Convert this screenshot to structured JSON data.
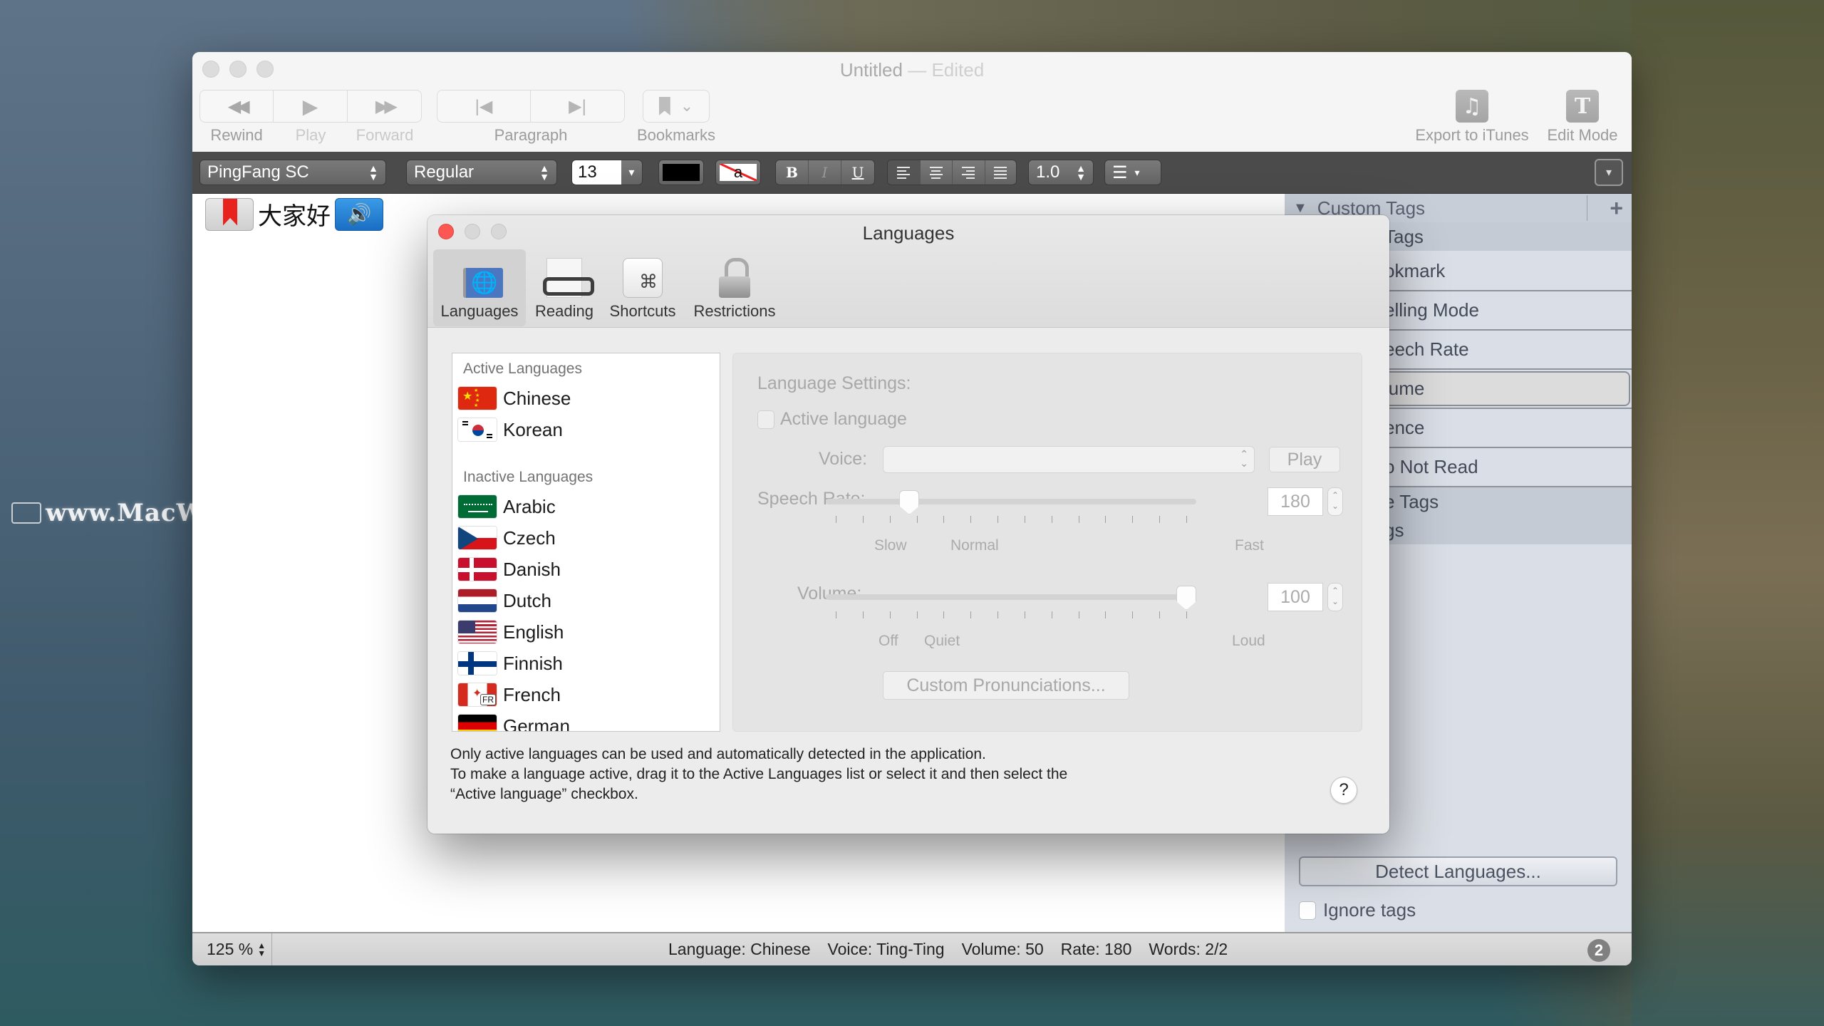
{
  "desktop": {
    "watermark": "www.MacW.com"
  },
  "window": {
    "title": "Untitled",
    "title_separator": "—",
    "title_status": "Edited"
  },
  "toolbar": {
    "rewind": {
      "label": "Rewind",
      "icon": "rewind-icon",
      "glyph": "◀◀"
    },
    "play": {
      "label": "Play",
      "icon": "play-icon",
      "glyph": "▶"
    },
    "forward": {
      "label": "Forward",
      "icon": "forward-icon",
      "glyph": "▶▶"
    },
    "paragraph": {
      "label": "Paragraph",
      "prev_glyph": "|◀",
      "next_glyph": "▶|"
    },
    "bookmarks": {
      "label": "Bookmarks",
      "glyph": "🔖",
      "chevron": "⌄"
    },
    "export": {
      "label": "Export to iTunes",
      "glyph": "♫"
    },
    "edit_mode": {
      "label": "Edit Mode",
      "glyph": "T"
    }
  },
  "formatbar": {
    "font_family": "PingFang SC",
    "font_style": "Regular",
    "font_size": "13",
    "text_color": "#000000",
    "highlight_glyph": "a",
    "bold": "B",
    "italic": "I",
    "underline": "U",
    "line_spacing": "1.0",
    "list_glyph": "☰",
    "dropdown_glyph": "▾",
    "updown_up": "▲",
    "updown_down": "▼"
  },
  "document": {
    "text": "大家好",
    "speaker_glyph": "🔊"
  },
  "sidebar": {
    "header": "Custom Tags",
    "header_glyph": "▼",
    "add_glyph": "+",
    "rows": [
      {
        "label": "Tags",
        "kind": "group"
      },
      {
        "label": "okmark",
        "kind": "item"
      },
      {
        "label": "elling Mode",
        "kind": "item"
      },
      {
        "label": "eech Rate",
        "kind": "item"
      },
      {
        "label": "lume",
        "kind": "item",
        "selected": true
      },
      {
        "label": "ence",
        "kind": "item"
      },
      {
        "label": "o Not Read",
        "kind": "item"
      },
      {
        "label": "e Tags",
        "kind": "group"
      },
      {
        "label": "gs",
        "kind": "group"
      }
    ],
    "detect_button": "Detect Languages...",
    "ignore_tags_label": "Ignore tags",
    "ignore_tags_checked": false
  },
  "statusbar": {
    "zoom": "125 %",
    "language": "Language: Chinese",
    "voice": "Voice: Ting-Ting",
    "volume": "Volume: 50",
    "rate": "Rate: 180",
    "words": "Words: 2/2",
    "badge": "2"
  },
  "dialog": {
    "title": "Languages",
    "tabs": [
      {
        "label": "Languages",
        "active": true,
        "glyph": "🌐"
      },
      {
        "label": "Reading",
        "active": false
      },
      {
        "label": "Shortcuts",
        "active": false,
        "glyph": "⌘"
      },
      {
        "label": "Restrictions",
        "active": false
      }
    ],
    "active_header": "Active Languages",
    "inactive_header": "Inactive Languages",
    "active_languages": [
      {
        "name": "Chinese",
        "flag": "cn"
      },
      {
        "name": "Korean",
        "flag": "kr"
      }
    ],
    "inactive_languages": [
      {
        "name": "Arabic",
        "flag": "sa"
      },
      {
        "name": "Czech",
        "flag": "cz"
      },
      {
        "name": "Danish",
        "flag": "dk"
      },
      {
        "name": "Dutch",
        "flag": "nl"
      },
      {
        "name": "English",
        "flag": "us"
      },
      {
        "name": "Finnish",
        "flag": "fi"
      },
      {
        "name": "French",
        "flag": "ca-fr",
        "flag_badge": "FR"
      },
      {
        "name": "German",
        "flag": "de"
      }
    ],
    "settings": {
      "heading": "Language Settings:",
      "active_language_label": "Active language",
      "active_language_checked": false,
      "voice_label": "Voice:",
      "voice_value": "",
      "play_label": "Play",
      "rate_label": "Speech Rate:",
      "rate_value": "180",
      "rate_slider_fraction": 0.21,
      "rate_ticks": [
        "Slow",
        "Normal",
        "Fast"
      ],
      "volume_label": "Volume:",
      "volume_value": "100",
      "volume_slider_fraction": 1.0,
      "volume_ticks": [
        "Off",
        "Quiet",
        "Loud"
      ],
      "custom_pronunciations": "Custom Pronunciations...",
      "stepper_up": "⌃",
      "stepper_down": "⌄",
      "select_updown_up": "⌃",
      "select_updown_down": "⌄"
    },
    "info_lines": [
      "Only active languages can be used and automatically detected in the application.",
      "To make a language active, drag it to the Active Languages list or select it and then select the",
      "“Active language” checkbox."
    ],
    "help_glyph": "?"
  },
  "colors": {
    "close_red": "#fc5753",
    "selected_tab_bg": "#d2d2d2",
    "sidebar_bg": "#dadee6",
    "formatbar_bg": "#4b4b4b"
  }
}
